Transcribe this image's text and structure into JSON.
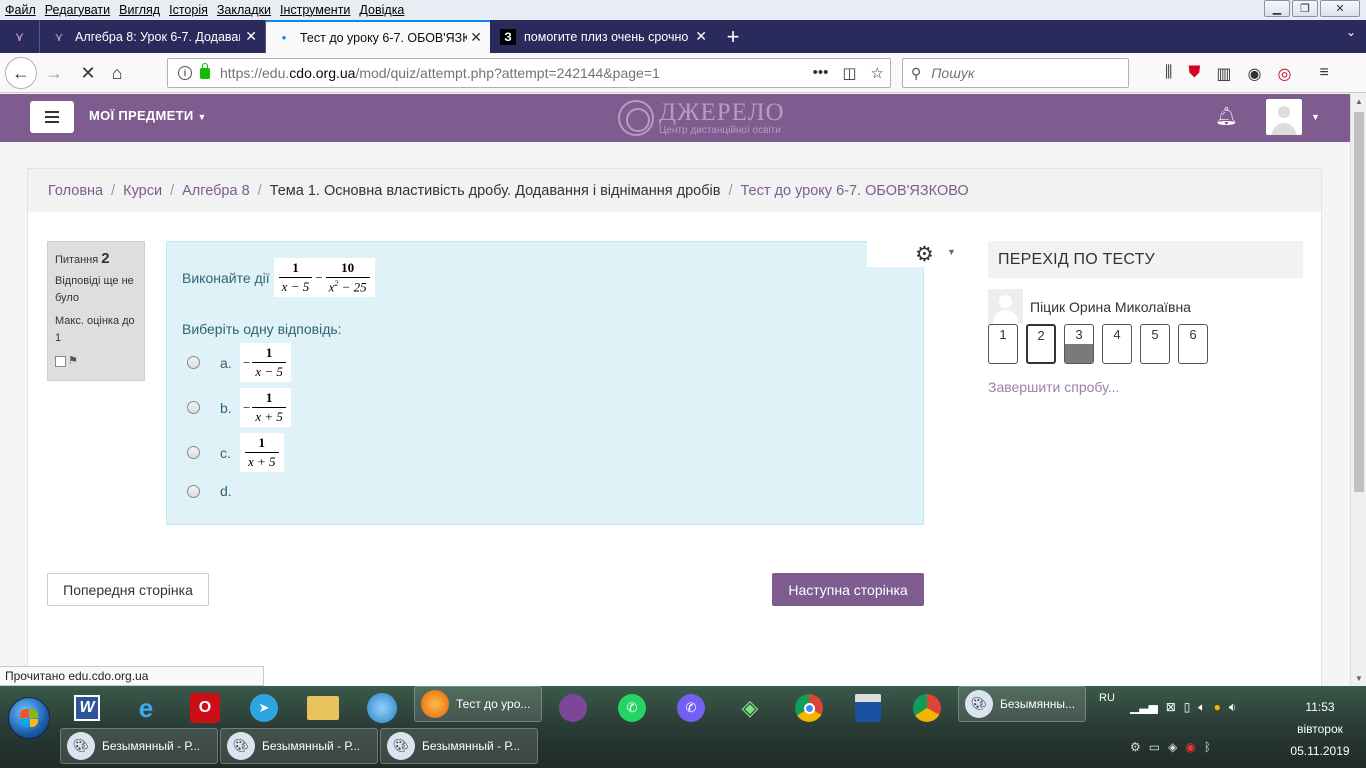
{
  "menubar": {
    "items": [
      "Файл",
      "Редагувати",
      "Вигляд",
      "Історія",
      "Закладки",
      "Інструменти",
      "Довідка"
    ]
  },
  "tabs": [
    {
      "label": "Алгебра 8: Урок 6-7. Додаван",
      "icon": "moodle-icon"
    },
    {
      "label": "Тест до уроку 6-7. ОБОВ'ЯЗКО",
      "icon": "loading-dot-icon",
      "active": true
    },
    {
      "label": "помогите плиз очень срочно",
      "icon": "znanija-icon"
    }
  ],
  "urlbar": {
    "url_prefix": "https://edu.",
    "url_domain": "cdo.org.ua",
    "url_path": "/mod/quiz/attempt.php?attempt=242144&page=1",
    "search_placeholder": "Пошук"
  },
  "site": {
    "menu": "МОЇ ПРЕДМЕТИ",
    "logo_name": "ДЖЕРЕЛО",
    "logo_sub": "Центр дистанційної освіти"
  },
  "breadcrumb": {
    "items": [
      "Головна",
      "Курси",
      "Алгебра 8",
      "Тема 1. Основна властивість дробу. Додавання і віднімання дробів",
      "Тест до уроку 6-7. ОБОВ'ЯЗКОВО"
    ]
  },
  "qinfo": {
    "label": "Питання",
    "number": "2",
    "state": "Відповіді ще не було",
    "grade": "Макс. оцінка до 1"
  },
  "question": {
    "text": "Виконайте дії",
    "f1_num": "1",
    "f1_den": "x − 5",
    "f2_num": "10",
    "f2_den_a": "x",
    "f2_den_exp": "2",
    "f2_den_b": " − 25",
    "choose": "Виберіть одну відповідь:",
    "options": [
      {
        "label": "a.",
        "sign": "−",
        "num": "1",
        "den": "x − 5"
      },
      {
        "label": "b.",
        "sign": "−",
        "num": "1",
        "den": "x + 5"
      },
      {
        "label": "c.",
        "sign": "",
        "num": "1",
        "den": "x + 5"
      },
      {
        "label": "d."
      }
    ]
  },
  "buttons": {
    "prev": "Попередня сторінка",
    "next": "Наступна сторінка"
  },
  "quiznav": {
    "title": "ПЕРЕХІД ПО ТЕСТУ",
    "user": "Піцик Орина Миколаївна",
    "questions": [
      "1",
      "2",
      "3",
      "4",
      "5",
      "6"
    ],
    "current": "2",
    "answered": [
      "3"
    ],
    "finish": "Завершити спробу..."
  },
  "status": "Прочитано edu.cdo.org.ua",
  "taskbar": {
    "firefox_task": "Тест до уро...",
    "paint_task": "Безымянны...",
    "paint_windows": [
      "Безымянный - Р...",
      "Безымянный - Р...",
      "Безымянный - Р..."
    ],
    "lang": "RU",
    "time": "11:53",
    "day": "вівторок",
    "date": "05.11.2019"
  }
}
